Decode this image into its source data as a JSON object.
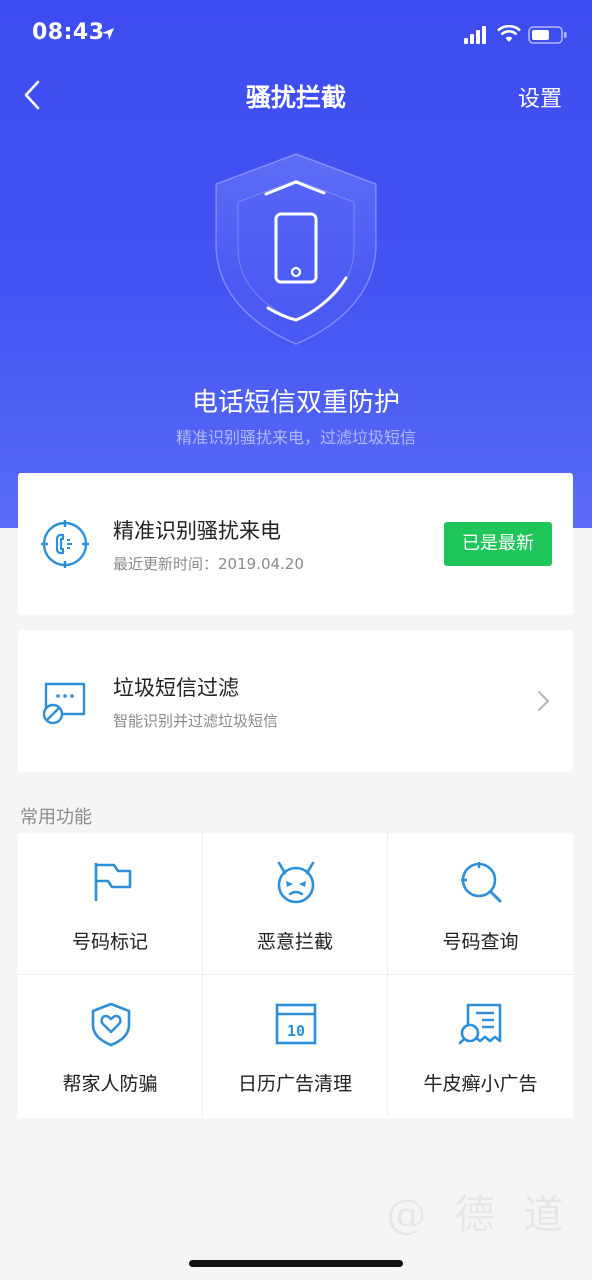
{
  "status_bar": {
    "time": "08:43"
  },
  "nav": {
    "title": "骚扰拦截",
    "settings_label": "设置"
  },
  "hero": {
    "title": "电话短信双重防护",
    "subtitle": "精准识别骚扰来电，过滤垃圾短信"
  },
  "cards": {
    "calls": {
      "title": "精准识别骚扰来电",
      "subtitle": "最近更新时间：2019.04.20",
      "button_label": "已是最新"
    },
    "sms": {
      "title": "垃圾短信过滤",
      "subtitle": "智能识别并过滤垃圾短信"
    }
  },
  "common": {
    "section_label": "常用功能",
    "items": [
      {
        "label": "号码标记",
        "icon": "flag-icon"
      },
      {
        "label": "恶意拦截",
        "icon": "devil-face-icon"
      },
      {
        "label": "号码查询",
        "icon": "search-target-icon"
      },
      {
        "label": "帮家人防骗",
        "icon": "heart-shield-icon"
      },
      {
        "label": "日历广告清理",
        "icon": "calendar-icon",
        "icon_text": "10"
      },
      {
        "label": "牛皮癣小广告",
        "icon": "receipt-search-icon"
      }
    ]
  },
  "watermark": "@ 德 道",
  "colors": {
    "hero_blue": "#3d4cf0",
    "accent_blue": "#2e8fd8",
    "success_green": "#1ec65a"
  }
}
